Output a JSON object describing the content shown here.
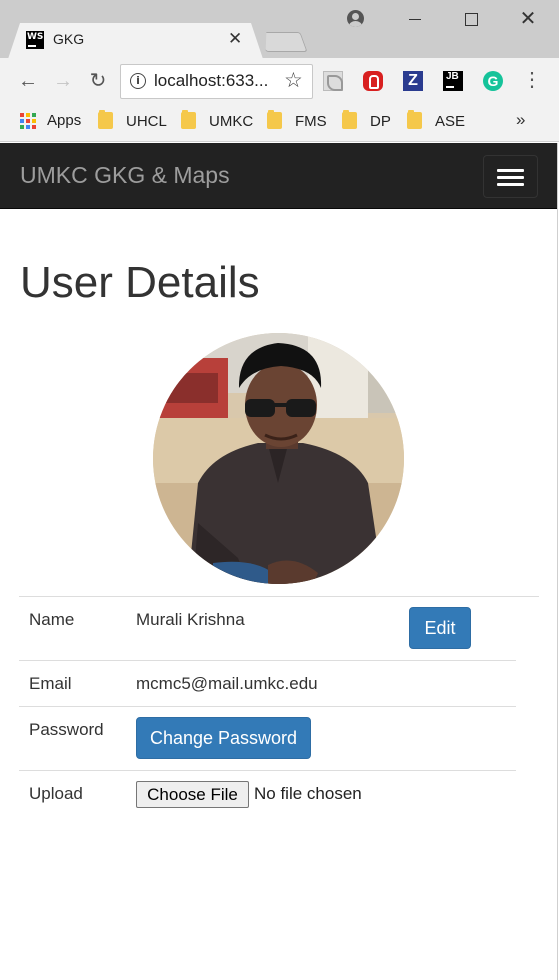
{
  "browser": {
    "tab_title": "GKG",
    "tab_favicon_text": "WS",
    "url": "localhost:633...",
    "bookmarks": [
      {
        "label": "Apps"
      },
      {
        "label": "UHCL"
      },
      {
        "label": "UMKC"
      },
      {
        "label": "FMS"
      },
      {
        "label": "DP"
      },
      {
        "label": "ASE"
      }
    ],
    "more_bookmarks": "»",
    "extensions": [
      "adobe-pdf-icon",
      "stop-adblock-icon",
      "zotero-icon",
      "jetbrains-icon",
      "grammarly-icon"
    ],
    "extension_labels": {
      "zotero": "Z",
      "jetbrains": "JB",
      "grammarly": "G"
    }
  },
  "navbar": {
    "brand": "UMKC GKG & Maps",
    "background": "#222222"
  },
  "page": {
    "title": "User Details",
    "rows": {
      "name": {
        "label": "Name",
        "value": "Murali Krishna",
        "action": "Edit"
      },
      "email": {
        "label": "Email",
        "value": "mcmc5@mail.umkc.edu"
      },
      "password": {
        "label": "Password",
        "action": "Change Password"
      },
      "upload": {
        "label": "Upload",
        "button": "Choose File",
        "status": "No file chosen"
      }
    }
  },
  "colors": {
    "primary_button": "#337ab7",
    "text": "#333333",
    "divider": "#dddddd"
  }
}
